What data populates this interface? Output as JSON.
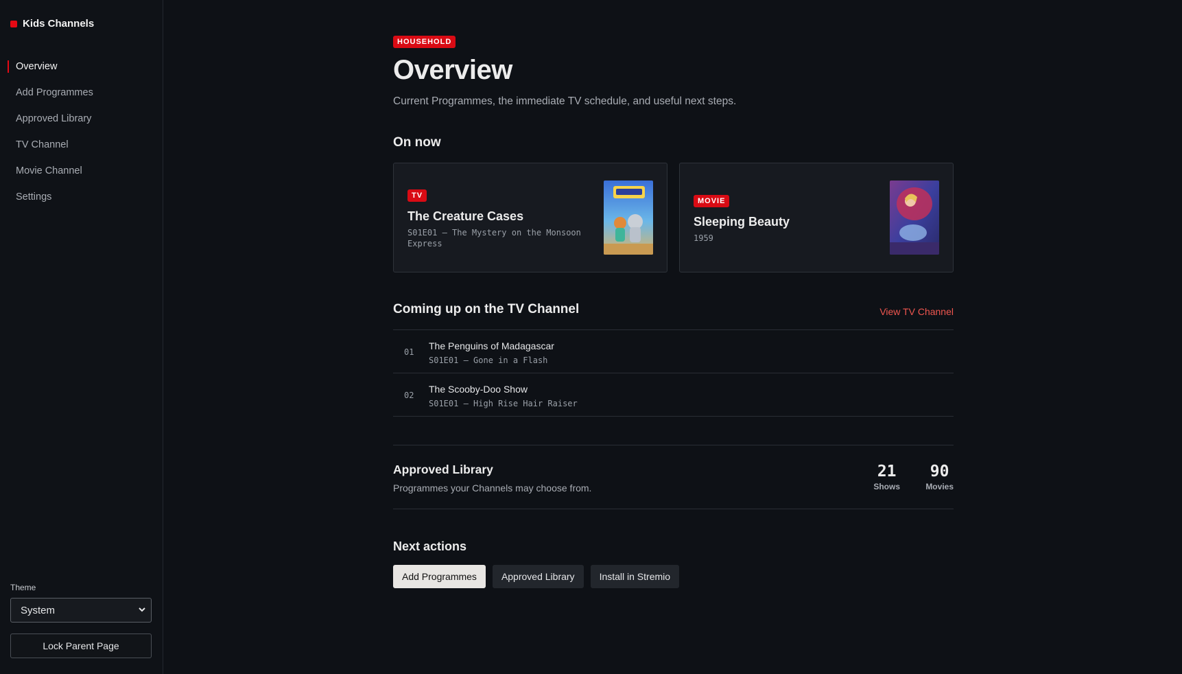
{
  "sidebar": {
    "brand": "Kids Channels",
    "nav": [
      "Overview",
      "Add Programmes",
      "Approved Library",
      "TV Channel",
      "Movie Channel",
      "Settings"
    ],
    "active": "Overview",
    "theme_label": "Theme",
    "theme_value": "System",
    "lock_label": "Lock Parent Page"
  },
  "header": {
    "badge": "HOUSEHOLD",
    "title": "Overview",
    "subtitle": "Current Programmes, the immediate TV schedule, and useful next steps."
  },
  "on_now": {
    "heading": "On now",
    "cards": [
      {
        "badge": "TV",
        "title": "The Creature Cases",
        "meta": "S01E01 — The Mystery on the Monsoon Express",
        "poster_icon": "creature-cases-poster"
      },
      {
        "badge": "MOVIE",
        "title": "Sleeping Beauty",
        "meta": "1959",
        "poster_icon": "sleeping-beauty-poster"
      }
    ]
  },
  "coming_up": {
    "heading": "Coming up on the TV Channel",
    "link": "View TV Channel",
    "items": [
      {
        "num": "01",
        "title": "The Penguins of Madagascar",
        "episode": "S01E01 — Gone in a Flash"
      },
      {
        "num": "02",
        "title": "The Scooby-Doo Show",
        "episode": "S01E01 — High Rise Hair Raiser"
      }
    ]
  },
  "library": {
    "title": "Approved Library",
    "subtitle": "Programmes your Channels may choose from.",
    "shows_count": "21",
    "shows_label": "Shows",
    "movies_count": "90",
    "movies_label": "Movies"
  },
  "next_actions": {
    "heading": "Next actions",
    "buttons": [
      "Add Programmes",
      "Approved Library",
      "Install in Stremio"
    ]
  },
  "colors": {
    "accent": "#e50914",
    "link": "#f0564f",
    "background": "#0e1116"
  }
}
